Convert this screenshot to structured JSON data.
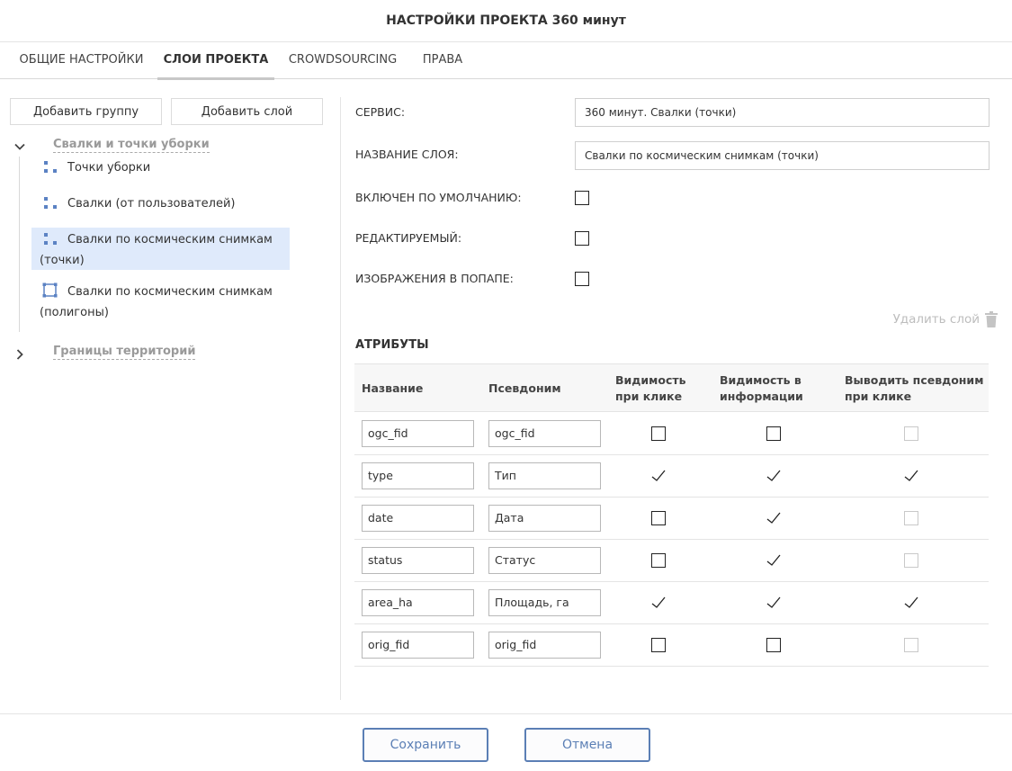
{
  "header": {
    "title": "НАСТРОЙКИ ПРОЕКТА 360 минут"
  },
  "tabs": [
    {
      "label": "ОБЩИЕ НАСТРОЙКИ",
      "active": false
    },
    {
      "label": "СЛОИ ПРОЕКТА",
      "active": true
    },
    {
      "label": "CROWDSOURCING",
      "active": false
    },
    {
      "label": "ПРАВА",
      "active": false
    }
  ],
  "sidebar": {
    "add_group_label": "Добавить группу",
    "add_layer_label": "Добавить слой",
    "groups": [
      {
        "label": "Свалки и точки уборки",
        "expanded": true,
        "layers": [
          {
            "label": "Точки уборки",
            "icon": "points-icon",
            "selected": false
          },
          {
            "label": "Свалки (от пользователей)",
            "icon": "points-icon",
            "selected": false
          },
          {
            "label": "Свалки по космическим снимкам (точки)",
            "icon": "points-icon",
            "selected": true
          },
          {
            "label": "Свалки по космическим снимкам (полигоны)",
            "icon": "polygon-icon",
            "selected": false
          }
        ]
      },
      {
        "label": "Границы территорий",
        "expanded": false,
        "layers": []
      }
    ]
  },
  "form": {
    "service_label": "СЕРВИС:",
    "service_value": "360 минут. Свалки (точки)",
    "layer_name_label": "НАЗВАНИЕ СЛОЯ:",
    "layer_name_value": "Свалки по космическим снимкам (точки)",
    "enabled_default_label": "ВКЛЮЧЕН ПО УМОЛЧАНИЮ:",
    "enabled_default": false,
    "editable_label": "РЕДАКТИРУЕМЫЙ:",
    "editable": false,
    "popup_images_label": "ИЗОБРАЖЕНИЯ В ПОПАПЕ:",
    "popup_images": false,
    "delete_layer_label": "Удалить слой"
  },
  "attributes": {
    "title": "АТРИБУТЫ",
    "columns": [
      "Название",
      "Псевдоним",
      "Видимость при клике",
      "Видимость в информации",
      "Выводить псевдоним при клике"
    ],
    "rows": [
      {
        "name": "ogc_fid",
        "alias": "ogc_fid",
        "visible_click": false,
        "visible_info": false,
        "alias_click": false,
        "alias_click_enabled": false
      },
      {
        "name": "type",
        "alias": "Тип",
        "visible_click": true,
        "visible_info": true,
        "alias_click": true,
        "alias_click_enabled": true
      },
      {
        "name": "date",
        "alias": "Дата",
        "visible_click": false,
        "visible_info": true,
        "alias_click": false,
        "alias_click_enabled": false
      },
      {
        "name": "status",
        "alias": "Статус",
        "visible_click": false,
        "visible_info": true,
        "alias_click": false,
        "alias_click_enabled": false
      },
      {
        "name": "area_ha",
        "alias": "Площадь, га",
        "visible_click": true,
        "visible_info": true,
        "alias_click": true,
        "alias_click_enabled": true
      },
      {
        "name": "orig_fid",
        "alias": "orig_fid",
        "visible_click": false,
        "visible_info": false,
        "alias_click": false,
        "alias_click_enabled": false
      }
    ]
  },
  "footer": {
    "save_label": "Сохранить",
    "cancel_label": "Отмена"
  },
  "colors": {
    "accent": "#5b7fb5",
    "selected_bg": "#dfeafb",
    "icon_blue": "#5b82c3",
    "muted": "#9a9a9a"
  }
}
